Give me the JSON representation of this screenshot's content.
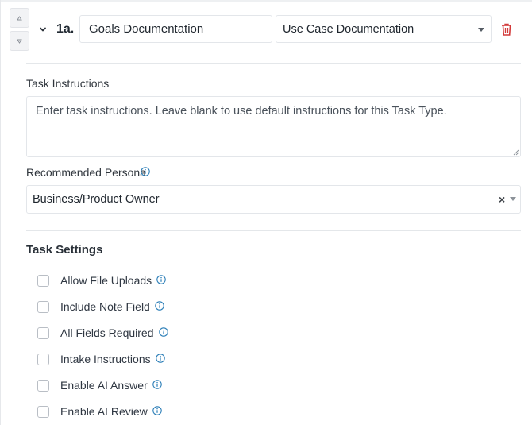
{
  "task": {
    "number": "1a.",
    "name_value": "Goals Documentation",
    "type_value": "Use Case Documentation"
  },
  "instructions": {
    "label": "Task Instructions",
    "placeholder": "Enter task instructions. Leave blank to use default instructions for this Task Type."
  },
  "persona": {
    "label": "Recommended Persona",
    "value": "Business/Product Owner",
    "clear": "×"
  },
  "settings": {
    "title": "Task Settings",
    "items": [
      {
        "label": "Allow File Uploads",
        "checked": false
      },
      {
        "label": "Include Note Field",
        "checked": false
      },
      {
        "label": "All Fields Required",
        "checked": false
      },
      {
        "label": "Intake Instructions",
        "checked": false
      },
      {
        "label": "Enable AI Answer",
        "checked": false
      },
      {
        "label": "Enable AI Review",
        "checked": false
      }
    ]
  },
  "colors": {
    "accent": "#2d7fb8",
    "danger": "#d33a3a",
    "border": "#e3e6ea"
  },
  "icons": {
    "move_up": "caret-up-icon",
    "move_down": "caret-down-icon",
    "collapse": "chevron-down-icon",
    "delete": "trash-icon",
    "info": "info-icon",
    "dropdown": "caret-down-icon"
  }
}
